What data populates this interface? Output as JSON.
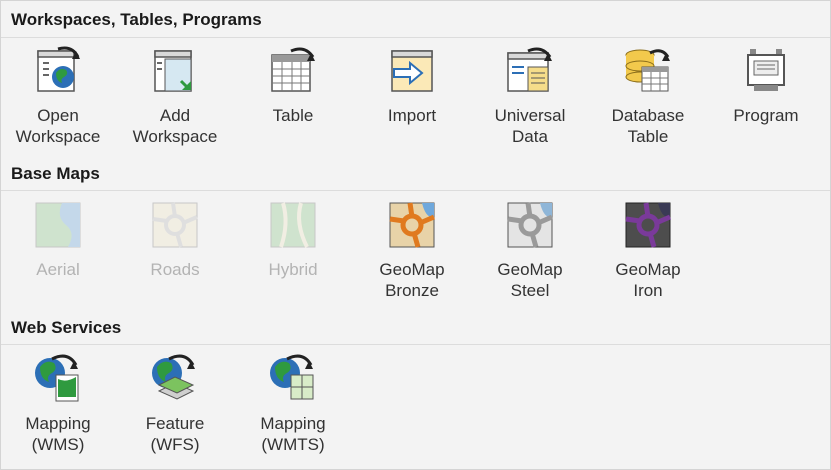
{
  "sections": {
    "workspaces": {
      "title": "Workspaces, Tables, Programs",
      "items": [
        {
          "label": "Open\nWorkspace",
          "icon": "open-workspace-icon"
        },
        {
          "label": "Add\nWorkspace",
          "icon": "add-workspace-icon"
        },
        {
          "label": "Table",
          "icon": "table-icon"
        },
        {
          "label": "Import",
          "icon": "import-icon"
        },
        {
          "label": "Universal\nData",
          "icon": "universal-data-icon"
        },
        {
          "label": "Database\nTable",
          "icon": "database-table-icon"
        },
        {
          "label": "Program",
          "icon": "program-icon"
        }
      ]
    },
    "basemaps": {
      "title": "Base Maps",
      "items": [
        {
          "label": "Aerial",
          "icon": "aerial-map-icon",
          "disabled": true
        },
        {
          "label": "Roads",
          "icon": "roads-map-icon",
          "disabled": true
        },
        {
          "label": "Hybrid",
          "icon": "hybrid-map-icon",
          "disabled": true
        },
        {
          "label": "GeoMap\nBronze",
          "icon": "geomap-bronze-icon"
        },
        {
          "label": "GeoMap\nSteel",
          "icon": "geomap-steel-icon"
        },
        {
          "label": "GeoMap\nIron",
          "icon": "geomap-iron-icon"
        }
      ]
    },
    "webservices": {
      "title": "Web Services",
      "items": [
        {
          "label": "Mapping\n(WMS)",
          "icon": "mapping-wms-icon"
        },
        {
          "label": "Feature\n(WFS)",
          "icon": "feature-wfs-icon"
        },
        {
          "label": "Mapping\n(WMTS)",
          "icon": "mapping-wmts-icon"
        }
      ]
    }
  },
  "colors": {
    "background": "#f3f3f3",
    "divider": "#dcdcdc",
    "disabled_text": "#b3b3b3",
    "bronze_road": "#e07a1f",
    "steel_road": "#9a9a9a",
    "iron_road": "#7a3a9a",
    "globe_green": "#2f9a3f",
    "globe_blue": "#2c6fb6"
  }
}
